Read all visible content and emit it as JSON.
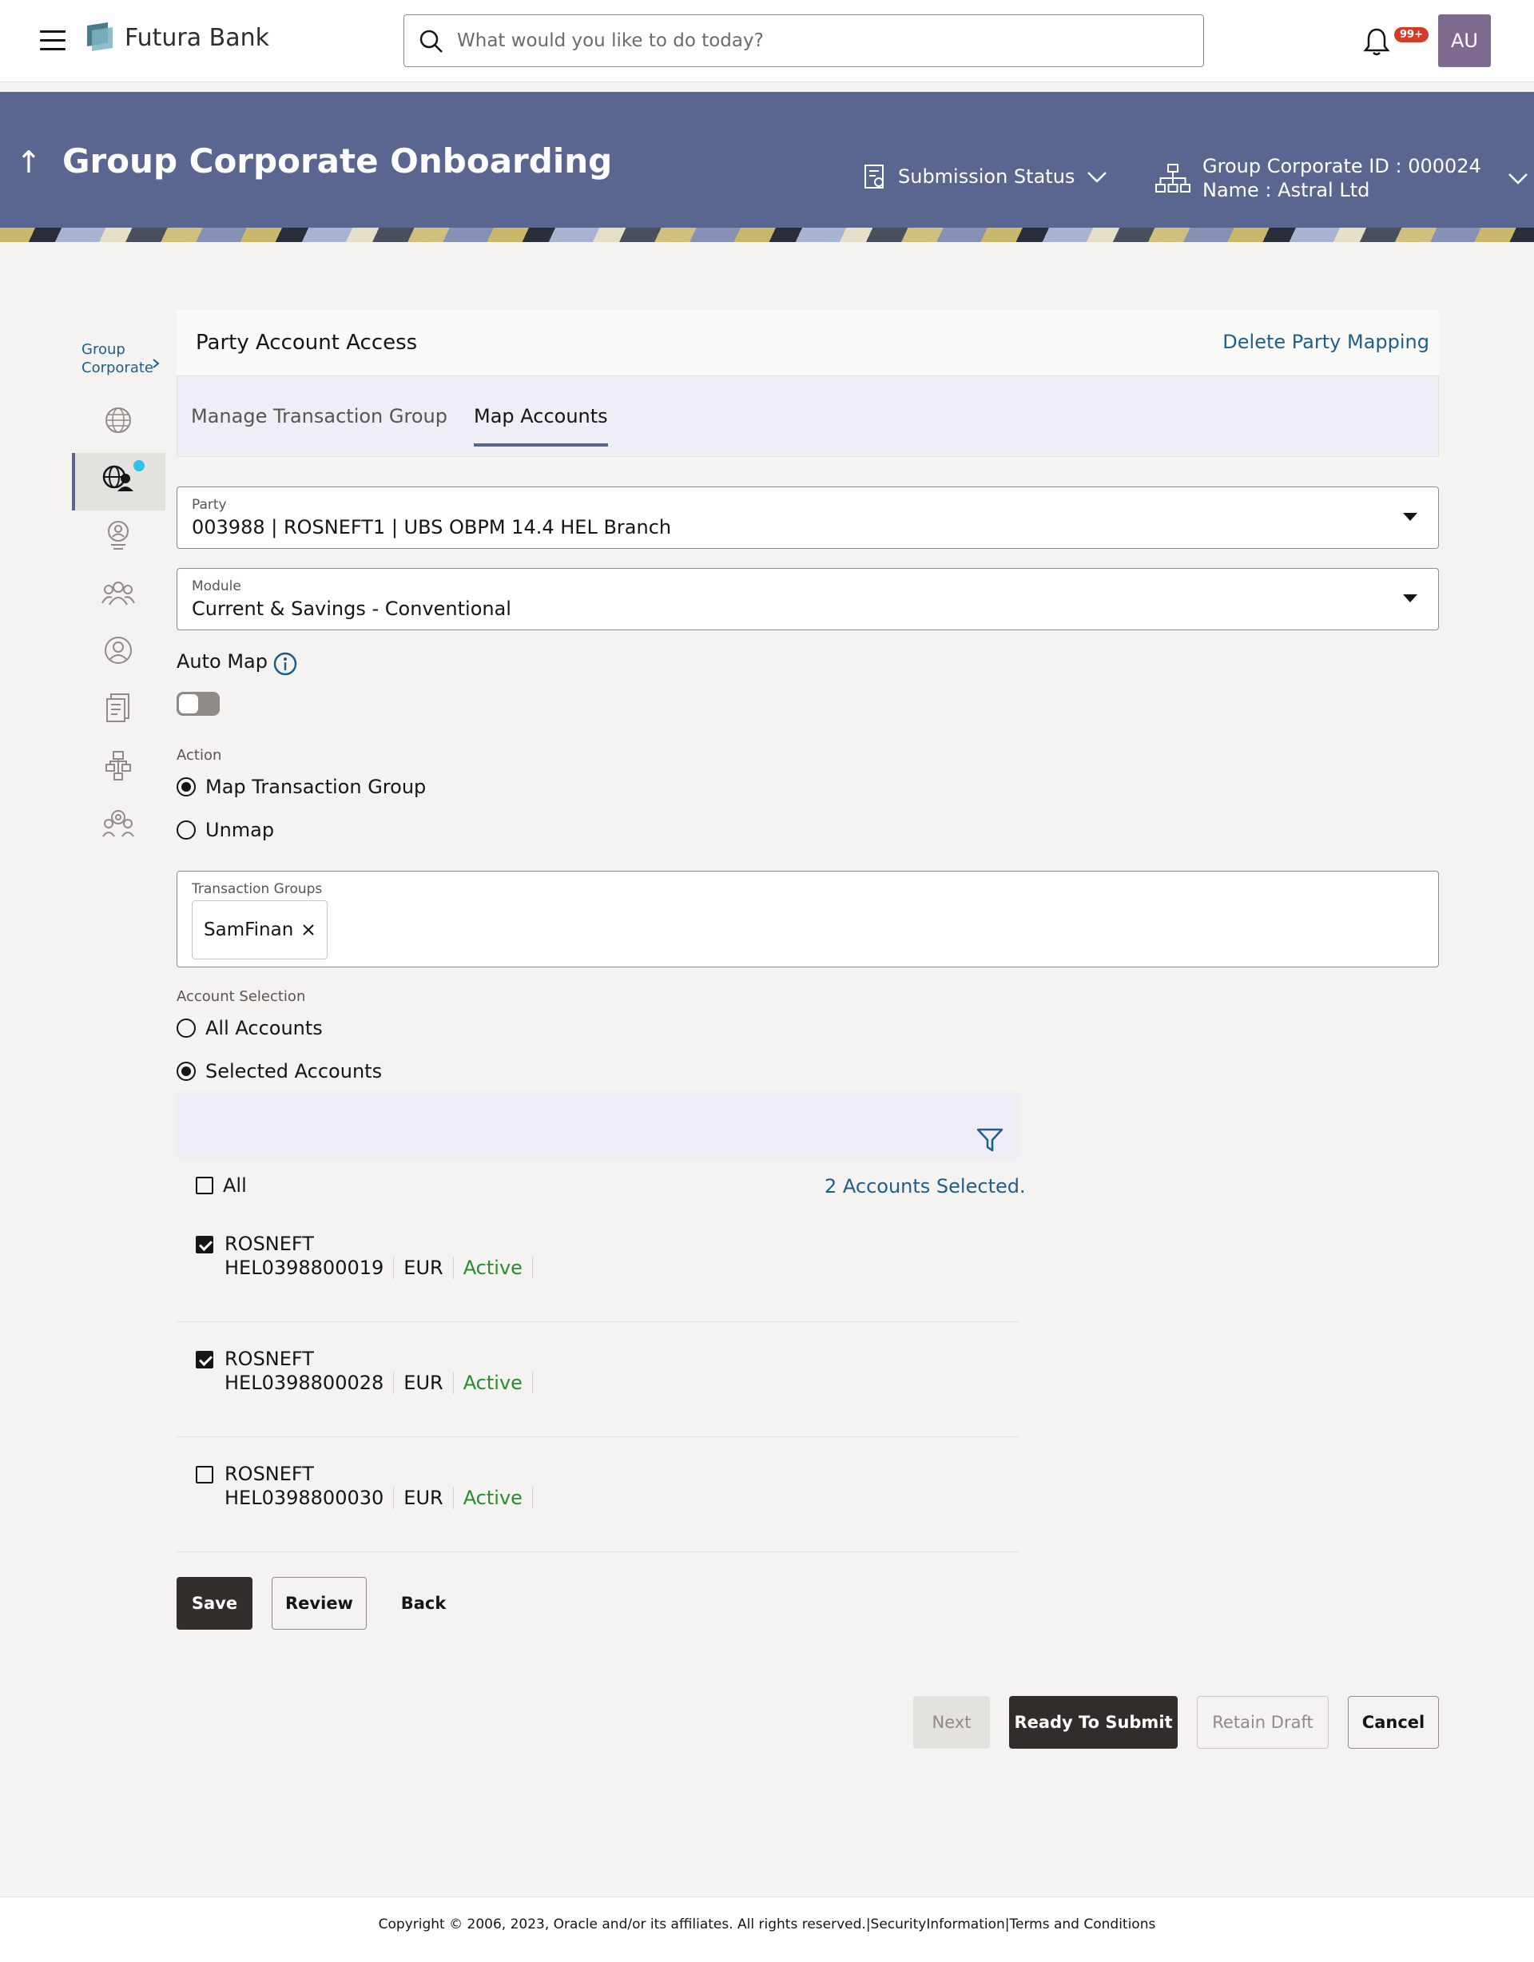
{
  "header": {
    "brand": "Futura Bank",
    "search_placeholder": "What would you like to do today?",
    "notification_badge": "99+",
    "avatar_initials": "AU"
  },
  "banner": {
    "title": "Group Corporate Onboarding",
    "submission_status": "Submission Status",
    "group_corporate_id": "Group Corporate ID : 000024",
    "group_corporate_name": "Name : Astral Ltd"
  },
  "sidebar": {
    "breadcrumb_line1": "Group",
    "breadcrumb_line2": "Corporate",
    "icons": [
      "globe-icon",
      "party-globe-icon",
      "user-badge-icon",
      "users-group-icon",
      "support-agent-icon",
      "document-list-icon",
      "org-tree-icon",
      "settings-people-icon"
    ]
  },
  "card": {
    "title": "Party Account Access",
    "delete_link": "Delete Party Mapping",
    "tabs": [
      {
        "label": "Manage Transaction Group",
        "active": false
      },
      {
        "label": "Map Accounts",
        "active": true
      }
    ]
  },
  "form": {
    "party_label": "Party",
    "party_value": "003988 | ROSNEFT1 | UBS OBPM 14.4 HEL Branch",
    "module_label": "Module",
    "module_value": "Current & Savings - Conventional",
    "auto_map_label": "Auto Map",
    "auto_map_on": false,
    "action_label": "Action",
    "action_options": [
      "Map Transaction Group",
      "Unmap"
    ],
    "action_selected": "Map Transaction Group",
    "transaction_groups_label": "Transaction Groups",
    "transaction_groups": [
      "SamFinan"
    ],
    "account_selection_label": "Account Selection",
    "account_selection_options": [
      "All Accounts",
      "Selected Accounts"
    ],
    "account_selection_selected": "Selected Accounts"
  },
  "accounts": {
    "all_label": "All",
    "selected_count_text": "2 Accounts Selected.",
    "list": [
      {
        "name": "ROSNEFT",
        "number": "HEL0398800019",
        "currency": "EUR",
        "status": "Active",
        "checked": true
      },
      {
        "name": "ROSNEFT",
        "number": "HEL0398800028",
        "currency": "EUR",
        "status": "Active",
        "checked": true
      },
      {
        "name": "ROSNEFT",
        "number": "HEL0398800030",
        "currency": "EUR",
        "status": "Active",
        "checked": false
      }
    ]
  },
  "actions": {
    "save": "Save",
    "review": "Review",
    "back": "Back",
    "next": "Next",
    "ready_to_submit": "Ready To Submit",
    "retain_draft": "Retain Draft",
    "cancel": "Cancel"
  },
  "footer": {
    "text": "Copyright © 2006, 2023, Oracle and/or its affiliates. All rights reserved.|SecurityInformation|Terms and Conditions"
  },
  "colors": {
    "banner": "#5b6690",
    "link": "#1c5f8a",
    "active_status": "#2b8a2b",
    "primary_button": "#312d2a"
  }
}
